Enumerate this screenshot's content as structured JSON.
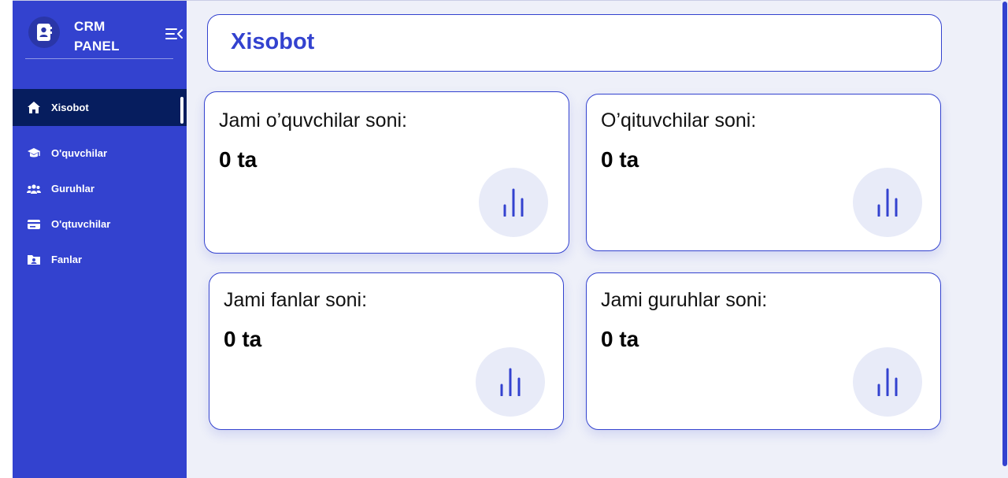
{
  "brand": {
    "line1": "CRM",
    "line2": "PANEL",
    "logo_icon": "contact-book-icon",
    "toggle_icon": "collapse-menu-icon"
  },
  "sidebar": {
    "items": [
      {
        "label": "Xisobot",
        "icon": "home-icon",
        "active": true
      },
      {
        "label": "O'quvchilar",
        "icon": "graduation-cap-icon"
      },
      {
        "label": "Guruhlar",
        "icon": "users-group-icon"
      },
      {
        "label": "O'qtuvchilar",
        "icon": "id-card-icon"
      },
      {
        "label": "Fanlar",
        "icon": "contact-folder-icon"
      }
    ]
  },
  "header": {
    "title": "Xisobot"
  },
  "stats": [
    {
      "label": "Jami o’quvchilar soni:",
      "value": "0 ta",
      "icon": "bar-chart-icon"
    },
    {
      "label": "O’qituvchilar soni:",
      "value": "0 ta",
      "icon": "bar-chart-icon"
    },
    {
      "label": "Jami fanlar soni:",
      "value": "0 ta",
      "icon": "bar-chart-icon"
    },
    {
      "label": "Jami guruhlar soni:",
      "value": "0 ta",
      "icon": "bar-chart-icon"
    }
  ],
  "colors": {
    "primary": "#3342cf",
    "active_nav": "#061d5e",
    "background": "#eef0f9",
    "icon_circle": "#e8ebf8"
  }
}
